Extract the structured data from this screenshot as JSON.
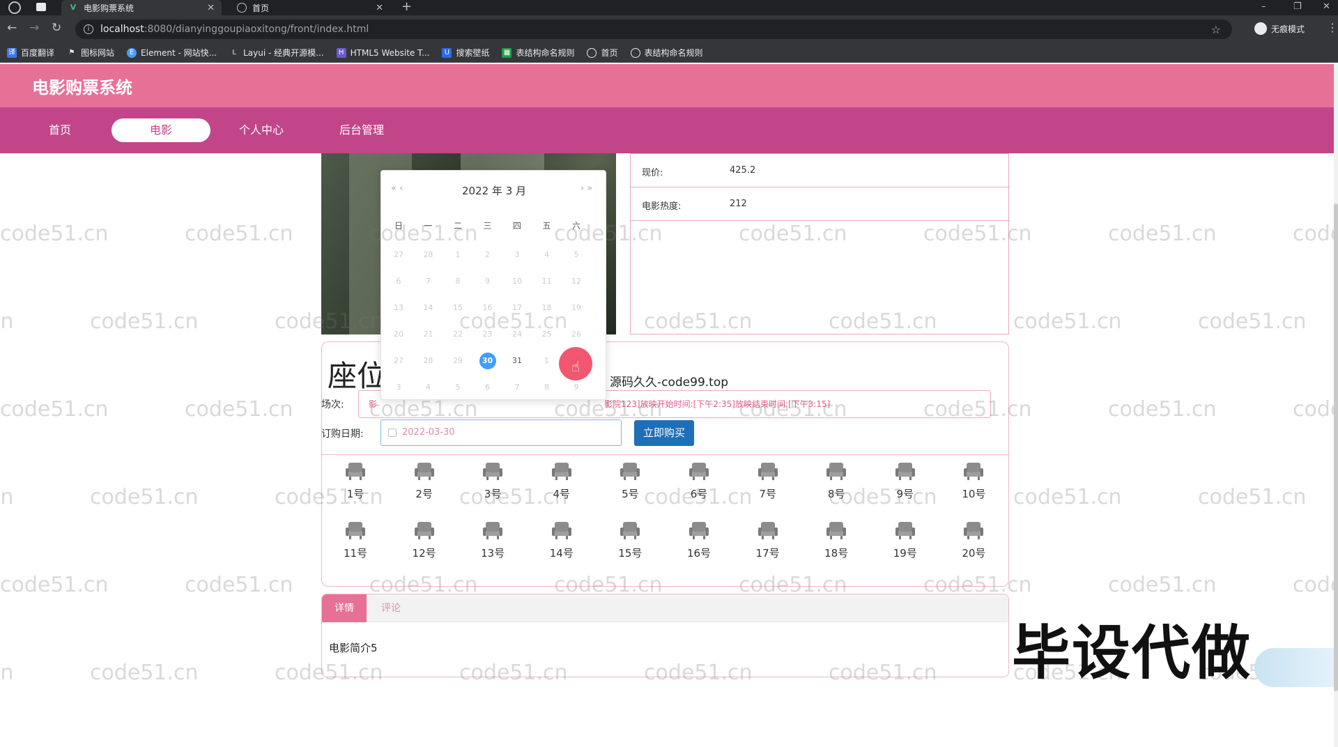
{
  "browser": {
    "tabs": [
      {
        "title": "电影购票系统",
        "active": true
      },
      {
        "title": "首页",
        "active": false
      }
    ],
    "url_host": "localhost",
    "url_path": ":8080/dianyinggoupiaoxitong/front/index.html",
    "incognito_label": "无痕模式",
    "bookmarks": [
      "百度翻译",
      "图标网站",
      "Element - 网站快...",
      "Layui - 经典开源模...",
      "HTML5 Website T...",
      "搜索壁纸",
      "表结构命名规则",
      "首页",
      "表结构命名规则"
    ]
  },
  "site": {
    "title": "电影购票系统",
    "nav": [
      "首页",
      "电影",
      "个人中心",
      "后台管理"
    ],
    "nav_active_index": 1
  },
  "movie_info": {
    "rows": [
      {
        "key": "现价:",
        "value": "425.2"
      },
      {
        "key": "电影热度:",
        "value": "212"
      }
    ]
  },
  "seat_section": {
    "heading": "座位",
    "heading_tail": "源码久久-code99.top",
    "session_label": "场次:",
    "session_value_start": "影",
    "session_value": "影院123]放映开始时间:[下午2:35]放映结束时间:[下午3:15]",
    "date_label": "订购日期:",
    "date_value": "2022-03-30",
    "buy_button": "立即购买",
    "seats": [
      "1号",
      "2号",
      "3号",
      "4号",
      "5号",
      "6号",
      "7号",
      "8号",
      "9号",
      "10号",
      "11号",
      "12号",
      "13号",
      "14号",
      "15号",
      "16号",
      "17号",
      "18号",
      "19号",
      "20号"
    ]
  },
  "calendar": {
    "header": "2022 年  3 月",
    "prev": "« ‹",
    "next": "› »",
    "weekdays": [
      "日",
      "一",
      "二",
      "三",
      "四",
      "五",
      "六"
    ],
    "days": [
      "27",
      "28",
      "1",
      "2",
      "3",
      "4",
      "5",
      "6",
      "7",
      "8",
      "9",
      "10",
      "11",
      "12",
      "13",
      "14",
      "15",
      "16",
      "17",
      "18",
      "19",
      "20",
      "21",
      "22",
      "23",
      "24",
      "25",
      "26",
      "27",
      "28",
      "29",
      "30",
      "31",
      "1",
      "2",
      "3",
      "4",
      "5",
      "6",
      "7",
      "8",
      "9"
    ],
    "today": "30"
  },
  "tabs": {
    "items": [
      "详情",
      "评论"
    ],
    "content": "电影简介5"
  },
  "watermark": "code51.cn",
  "overlay_text": "毕设代做"
}
